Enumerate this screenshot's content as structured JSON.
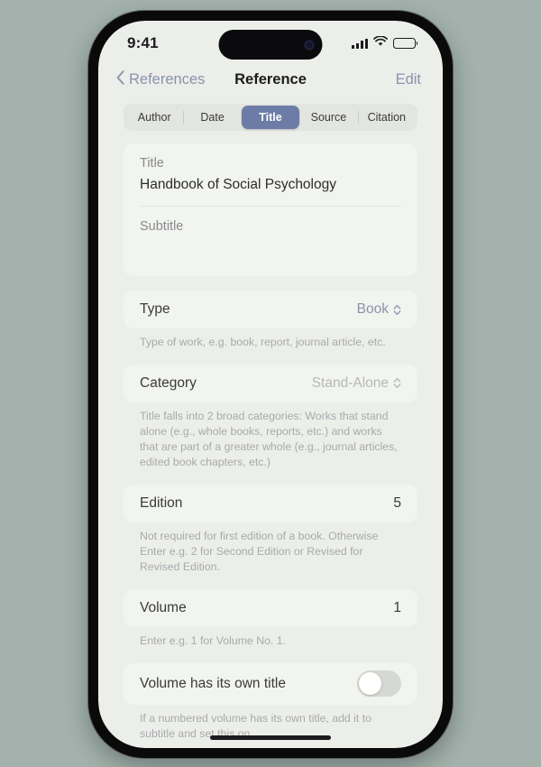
{
  "status_bar": {
    "time": "9:41",
    "signal_icon": "cellular-signal-icon",
    "wifi_icon": "wifi-icon",
    "battery_icon": "battery-full-icon"
  },
  "nav_bar": {
    "back_label": "References",
    "back_icon": "chevron-left-icon",
    "title": "Reference",
    "edit_label": "Edit"
  },
  "segmented_control": {
    "segments": [
      {
        "label": "Author",
        "selected": false
      },
      {
        "label": "Date",
        "selected": false
      },
      {
        "label": "Title",
        "selected": true
      },
      {
        "label": "Source",
        "selected": false
      },
      {
        "label": "Citation",
        "selected": false
      }
    ]
  },
  "form": {
    "title_field": {
      "label": "Title",
      "value": "Handbook of Social Psychology"
    },
    "subtitle_field": {
      "label": "Subtitle",
      "value": ""
    },
    "type_row": {
      "label": "Type",
      "value": "Book",
      "picker_icon": "chevron-up-down-icon",
      "help": "Type of work, e.g. book, report, journal article, etc."
    },
    "category_row": {
      "label": "Category",
      "value": "Stand-Alone",
      "picker_icon": "chevron-up-down-icon",
      "help": "Title falls into 2 broad categories: Works that stand alone (e.g., whole books, reports, etc.) and works that are part of a greater whole (e.g., journal articles, edited book chapters, etc.)"
    },
    "edition_row": {
      "label": "Edition",
      "value": "5",
      "help": "Not required for first edition of a book. Otherwise Enter e.g. 2 for Second Edition or Revised for Revised Edition."
    },
    "volume_row": {
      "label": "Volume",
      "value": "1",
      "help": "Enter e.g. 1 for Volume No. 1."
    },
    "volume_title_toggle": {
      "label": "Volume has its own title",
      "state": "off",
      "help": "If a numbered volume has its own title, add it to subtitle and set this on."
    }
  },
  "colors": {
    "page_background": "#a3b2ac",
    "screen_background": "#eceeea",
    "card_background": "#f2f4ef",
    "accent_selected": "#6d7ca7",
    "link": "#8b93ad"
  }
}
